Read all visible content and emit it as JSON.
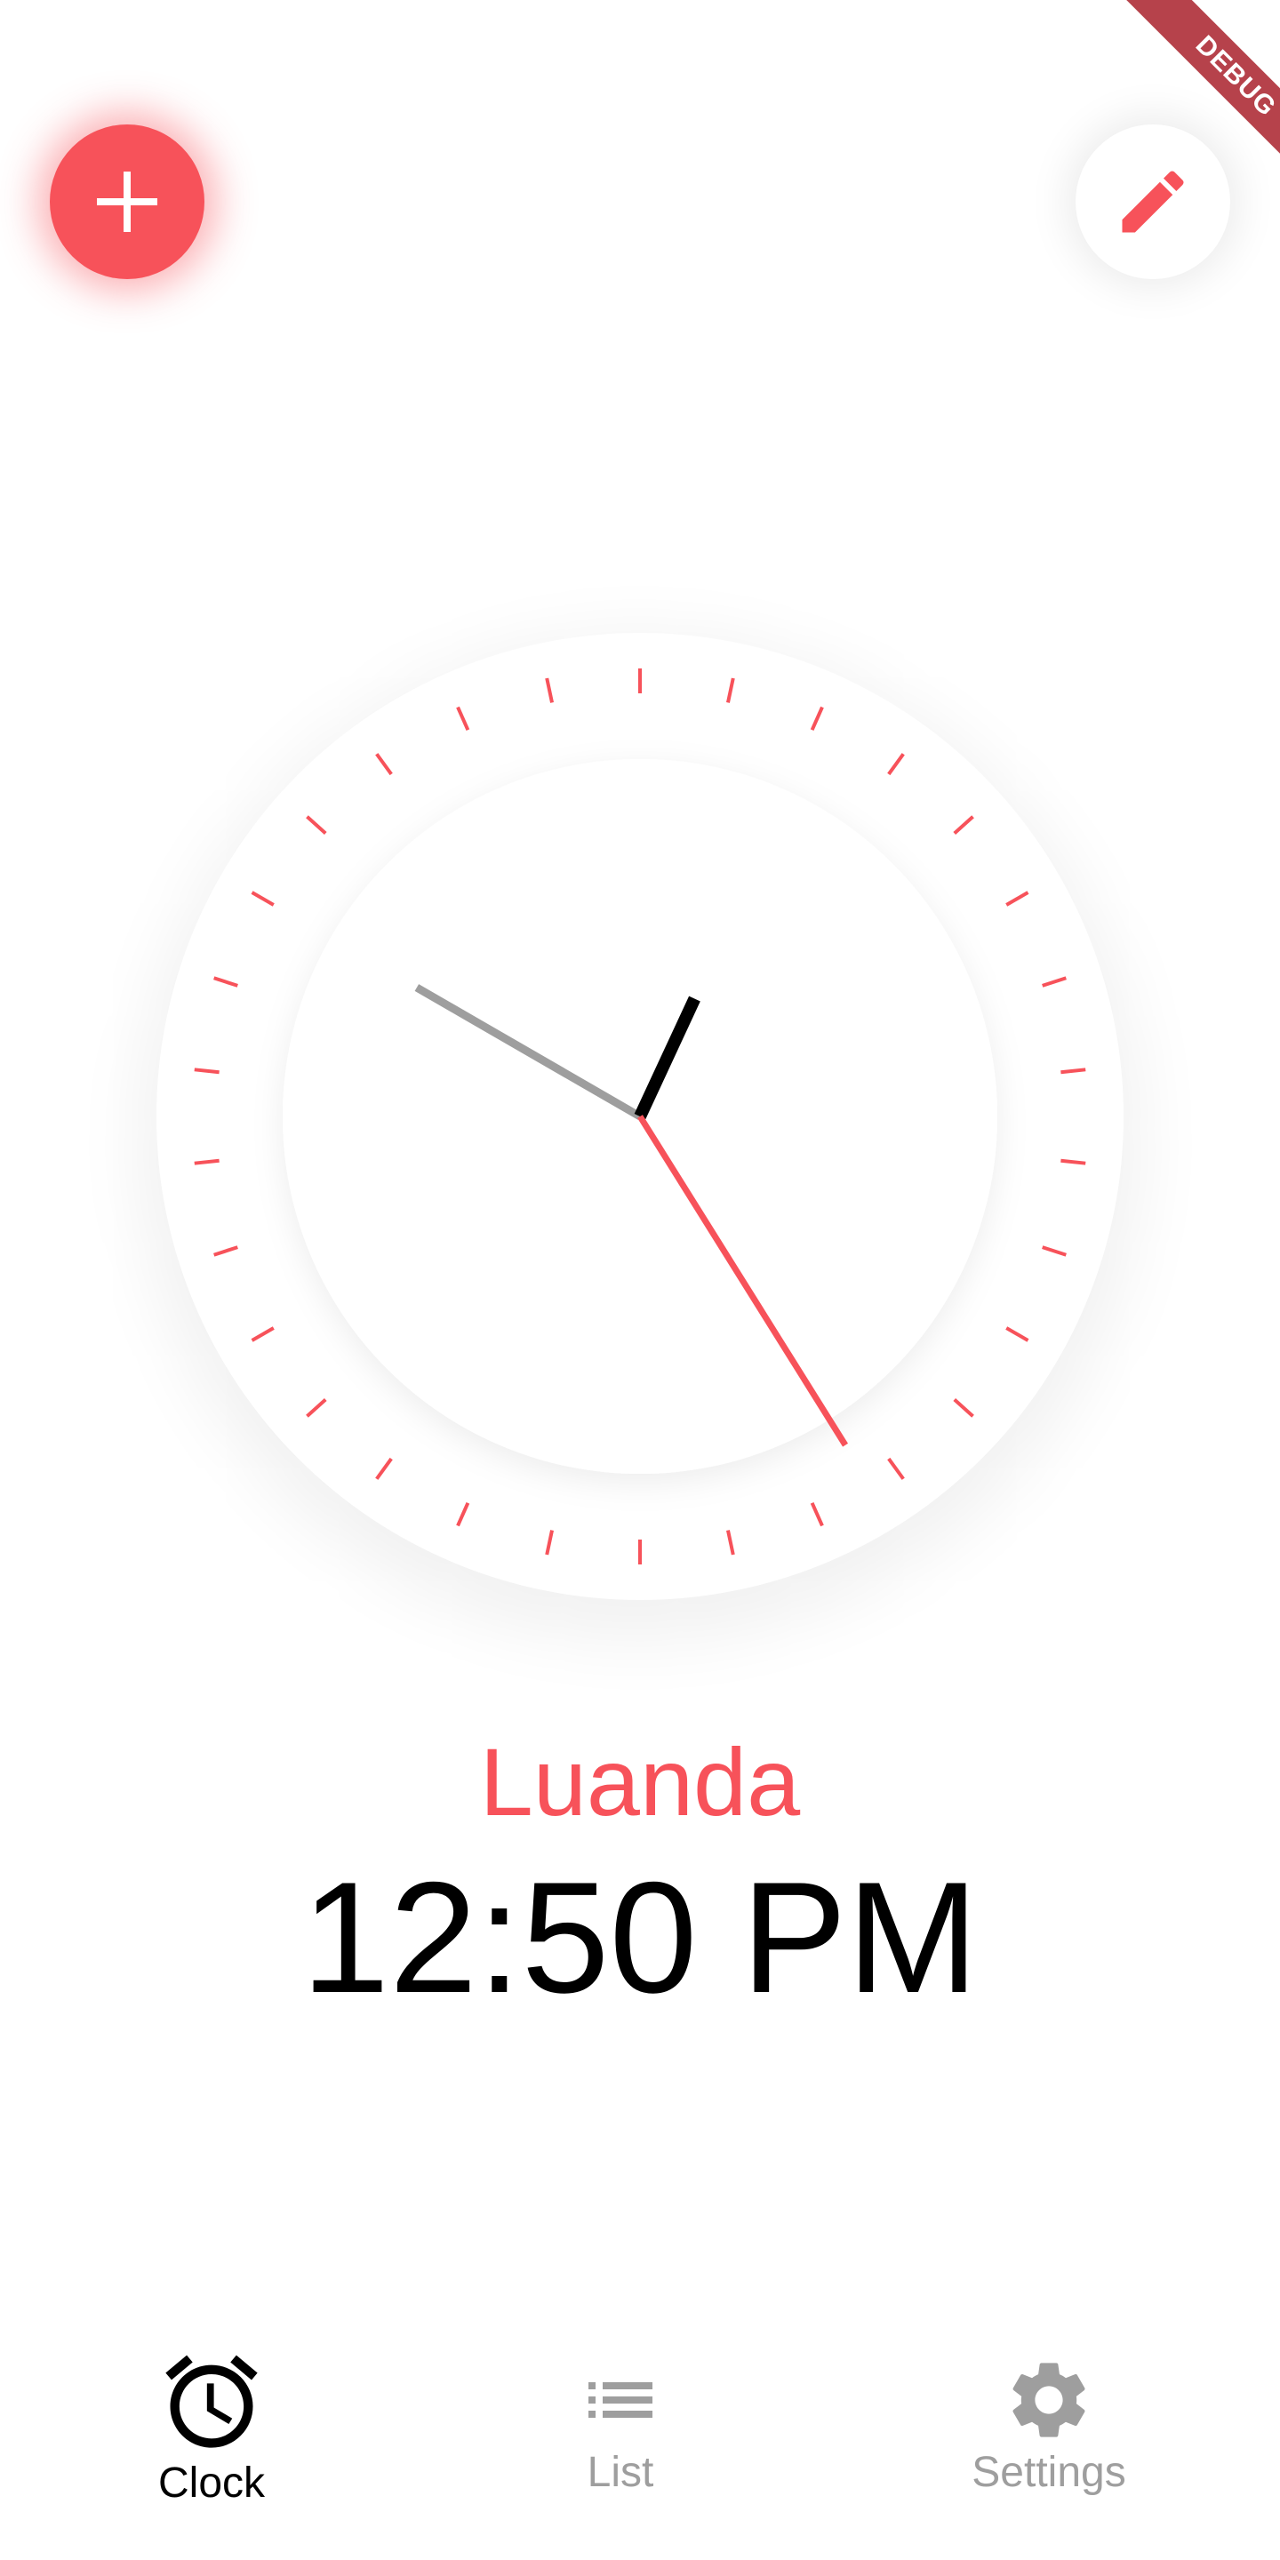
{
  "app": {
    "debug_banner": "DEBUG"
  },
  "actions": {
    "add_icon": "plus-icon",
    "edit_icon": "pencil-icon"
  },
  "clock": {
    "city": "Luanda",
    "time_text": "12:50 PM",
    "hour_hand_value": 12.83,
    "minute_hand_value": 50,
    "second_hand_value": 25,
    "colors": {
      "accent": "#f7525a",
      "hour_hand": "#000000",
      "minute_hand": "#9e9e9e",
      "second_hand": "#f7525a",
      "ticks": "#f7525a"
    }
  },
  "nav": {
    "items": [
      {
        "label": "Clock",
        "icon": "alarm-clock-icon",
        "active": true
      },
      {
        "label": "List",
        "icon": "list-icon",
        "active": false
      },
      {
        "label": "Settings",
        "icon": "gear-icon",
        "active": false
      }
    ],
    "active_color": "#000000",
    "inactive_color": "#9e9e9e"
  }
}
